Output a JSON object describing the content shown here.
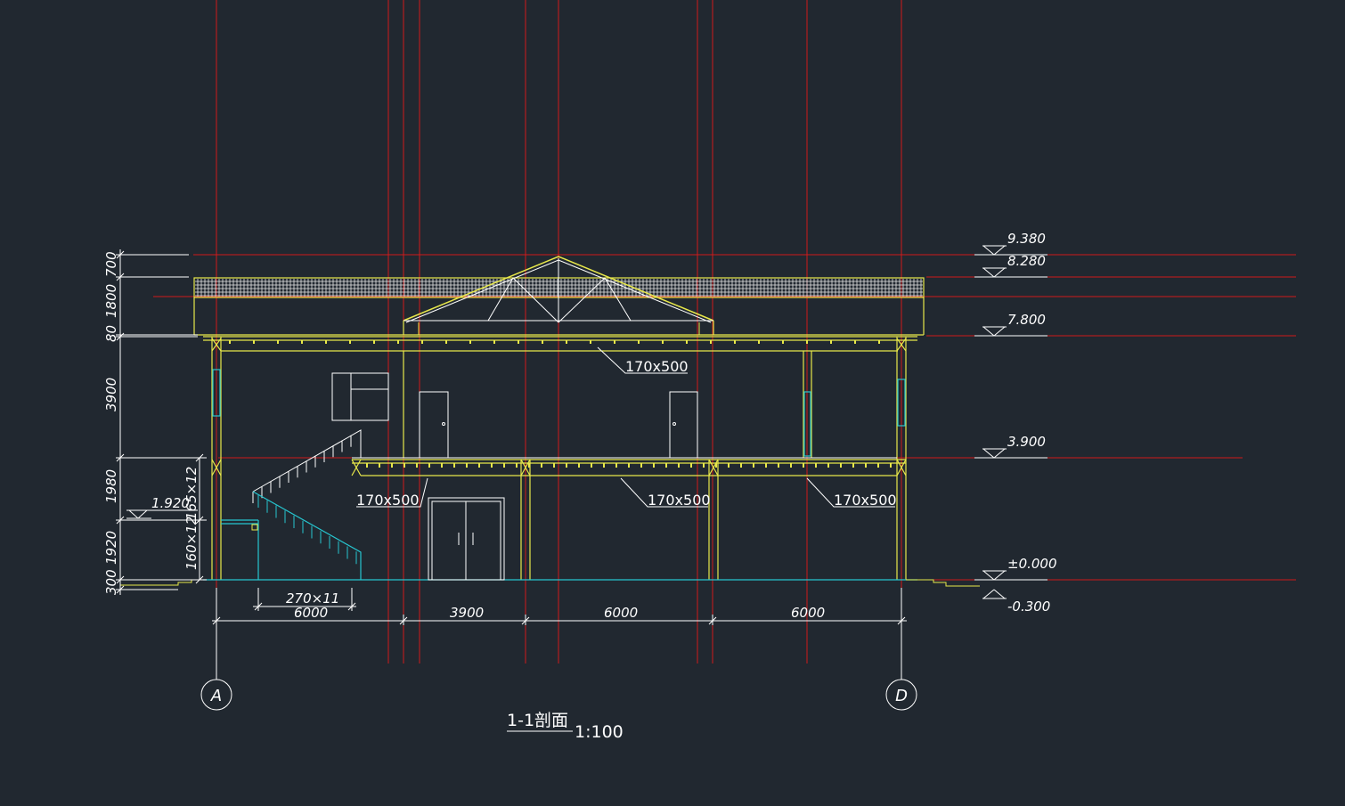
{
  "drawing": {
    "title": "1-1剖面",
    "scale": "1:100",
    "colors": {
      "background": "#212830",
      "axis_line": "#d01a1a",
      "structure": "#e8e84a",
      "stair": "#26c6d0",
      "annotation": "#ffffff"
    }
  },
  "axes": [
    {
      "label": "A"
    },
    {
      "label": "D"
    }
  ],
  "elevations": [
    {
      "value": "9.380"
    },
    {
      "value": "8.280"
    },
    {
      "value": "7.800"
    },
    {
      "value": "3.900"
    },
    {
      "value": "±0.000"
    },
    {
      "value": "-0.300"
    }
  ],
  "stair_landing_elevation": "1.920",
  "left_dimensions": [
    {
      "value": "700"
    },
    {
      "value": "1800"
    },
    {
      "value": "80"
    },
    {
      "value": "3900"
    },
    {
      "value": "1980"
    },
    {
      "value": "1920"
    },
    {
      "value": "300"
    }
  ],
  "stair_dimensions": [
    {
      "value": "165×12"
    },
    {
      "value": "160×12"
    }
  ],
  "tread_dimension": "270×11",
  "bottom_dimensions": [
    {
      "value": "6000"
    },
    {
      "value": "3900"
    },
    {
      "value": "6000"
    },
    {
      "value": "6000"
    }
  ],
  "beam_labels": [
    {
      "text": "170x500"
    },
    {
      "text": "170x500"
    },
    {
      "text": "170x500"
    },
    {
      "text": "170x500"
    }
  ]
}
